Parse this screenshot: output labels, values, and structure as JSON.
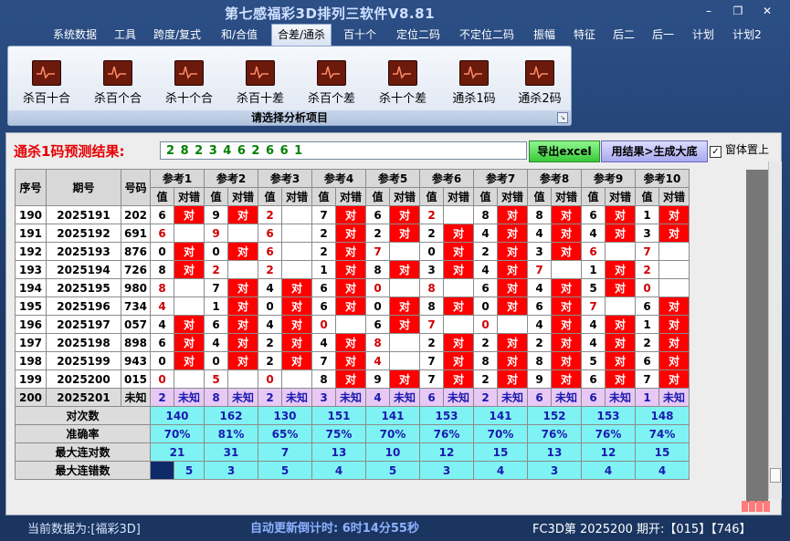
{
  "window": {
    "title": "第七感福彩3D排列三软件V8.81",
    "minimize": "–",
    "restore": "❐",
    "close": "✕"
  },
  "menu": [
    "系统数据",
    "工具",
    "跨度/复式",
    "和/合值",
    "合差/通杀",
    "百十个",
    "定位二码",
    "不定位二码",
    "振幅",
    "特征",
    "后二",
    "后一",
    "计划",
    "计划2"
  ],
  "ribbon": {
    "buttons": [
      "杀百十合",
      "杀百个合",
      "杀十个合",
      "杀百十差",
      "杀百个差",
      "杀十个差",
      "通杀1码",
      "通杀2码"
    ],
    "caption": "请选择分析项目"
  },
  "prediction": {
    "label": "通杀1码预测结果:",
    "value": "2 8 2 3 4 6 2 6 6 1",
    "export_button": "导出excel",
    "generate_button": "用结果>生成大底",
    "pin_label": "窗体置上",
    "pin_checked": true
  },
  "grid": {
    "headers": {
      "seq": "序号",
      "period": "期号",
      "code": "号码",
      "groups": [
        "参考1",
        "参考2",
        "参考3",
        "参考4",
        "参考5",
        "参考6",
        "参考7",
        "参考8",
        "参考9",
        "参考10"
      ],
      "val": "值",
      "mark": "对错"
    },
    "rows": [
      {
        "seq": "190",
        "period": "2025191",
        "code": "202",
        "cells": [
          [
            "6",
            "对"
          ],
          [
            "9",
            "对"
          ],
          [
            "2",
            ""
          ],
          [
            "7",
            "对"
          ],
          [
            "6",
            "对"
          ],
          [
            "2",
            ""
          ],
          [
            "8",
            "对"
          ],
          [
            "8",
            "对"
          ],
          [
            "6",
            "对"
          ],
          [
            "1",
            "对"
          ]
        ]
      },
      {
        "seq": "191",
        "period": "2025192",
        "code": "691",
        "cells": [
          [
            "6",
            ""
          ],
          [
            "9",
            ""
          ],
          [
            "6",
            ""
          ],
          [
            "2",
            "对"
          ],
          [
            "2",
            "对"
          ],
          [
            "2",
            "对"
          ],
          [
            "4",
            "对"
          ],
          [
            "4",
            "对"
          ],
          [
            "4",
            "对"
          ],
          [
            "3",
            "对"
          ]
        ]
      },
      {
        "seq": "192",
        "period": "2025193",
        "code": "876",
        "cells": [
          [
            "0",
            "对"
          ],
          [
            "0",
            "对"
          ],
          [
            "6",
            ""
          ],
          [
            "2",
            "对"
          ],
          [
            "7",
            ""
          ],
          [
            "0",
            "对"
          ],
          [
            "2",
            "对"
          ],
          [
            "3",
            "对"
          ],
          [
            "6",
            ""
          ],
          [
            "7",
            ""
          ]
        ]
      },
      {
        "seq": "193",
        "period": "2025194",
        "code": "726",
        "cells": [
          [
            "8",
            "对"
          ],
          [
            "2",
            ""
          ],
          [
            "2",
            ""
          ],
          [
            "1",
            "对"
          ],
          [
            "8",
            "对"
          ],
          [
            "3",
            "对"
          ],
          [
            "4",
            "对"
          ],
          [
            "7",
            ""
          ],
          [
            "1",
            "对"
          ],
          [
            "2",
            ""
          ]
        ]
      },
      {
        "seq": "194",
        "period": "2025195",
        "code": "980",
        "cells": [
          [
            "8",
            ""
          ],
          [
            "7",
            "对"
          ],
          [
            "4",
            "对"
          ],
          [
            "6",
            "对"
          ],
          [
            "0",
            ""
          ],
          [
            "8",
            ""
          ],
          [
            "6",
            "对"
          ],
          [
            "4",
            "对"
          ],
          [
            "5",
            "对"
          ],
          [
            "0",
            ""
          ]
        ]
      },
      {
        "seq": "195",
        "period": "2025196",
        "code": "734",
        "cells": [
          [
            "4",
            ""
          ],
          [
            "1",
            "对"
          ],
          [
            "0",
            "对"
          ],
          [
            "6",
            "对"
          ],
          [
            "0",
            "对"
          ],
          [
            "8",
            "对"
          ],
          [
            "0",
            "对"
          ],
          [
            "6",
            "对"
          ],
          [
            "7",
            ""
          ],
          [
            "6",
            "对"
          ]
        ]
      },
      {
        "seq": "196",
        "period": "2025197",
        "code": "057",
        "cells": [
          [
            "4",
            "对"
          ],
          [
            "6",
            "对"
          ],
          [
            "4",
            "对"
          ],
          [
            "0",
            ""
          ],
          [
            "6",
            "对"
          ],
          [
            "7",
            ""
          ],
          [
            "0",
            ""
          ],
          [
            "4",
            "对"
          ],
          [
            "4",
            "对"
          ],
          [
            "1",
            "对"
          ]
        ]
      },
      {
        "seq": "197",
        "period": "2025198",
        "code": "898",
        "cells": [
          [
            "6",
            "对"
          ],
          [
            "4",
            "对"
          ],
          [
            "2",
            "对"
          ],
          [
            "4",
            "对"
          ],
          [
            "8",
            ""
          ],
          [
            "2",
            "对"
          ],
          [
            "2",
            "对"
          ],
          [
            "2",
            "对"
          ],
          [
            "4",
            "对"
          ],
          [
            "2",
            "对"
          ]
        ]
      },
      {
        "seq": "198",
        "period": "2025199",
        "code": "943",
        "cells": [
          [
            "0",
            "对"
          ],
          [
            "0",
            "对"
          ],
          [
            "2",
            "对"
          ],
          [
            "7",
            "对"
          ],
          [
            "4",
            ""
          ],
          [
            "7",
            "对"
          ],
          [
            "8",
            "对"
          ],
          [
            "8",
            "对"
          ],
          [
            "5",
            "对"
          ],
          [
            "6",
            "对"
          ]
        ]
      },
      {
        "seq": "199",
        "period": "2025200",
        "code": "015",
        "cells": [
          [
            "0",
            ""
          ],
          [
            "5",
            ""
          ],
          [
            "0",
            ""
          ],
          [
            "8",
            "对"
          ],
          [
            "9",
            "对"
          ],
          [
            "7",
            "对"
          ],
          [
            "2",
            "对"
          ],
          [
            "9",
            "对"
          ],
          [
            "6",
            "对"
          ],
          [
            "7",
            "对"
          ]
        ]
      }
    ],
    "pred_row": {
      "seq": "200",
      "period": "2025201",
      "code": "未知",
      "values": [
        "2",
        "8",
        "2",
        "3",
        "4",
        "6",
        "2",
        "6",
        "6",
        "1"
      ],
      "mark": "未知"
    },
    "stats": [
      {
        "label": "对次数",
        "values": [
          "140",
          "162",
          "130",
          "151",
          "141",
          "153",
          "141",
          "152",
          "153",
          "148"
        ]
      },
      {
        "label": "准确率",
        "values": [
          "70%",
          "81%",
          "65%",
          "75%",
          "70%",
          "76%",
          "70%",
          "76%",
          "76%",
          "74%"
        ]
      },
      {
        "label": "最大连对数",
        "values": [
          "21",
          "31",
          "7",
          "13",
          "10",
          "12",
          "15",
          "13",
          "12",
          "15"
        ]
      },
      {
        "label": "最大连错数",
        "values": [
          "5",
          "3",
          "5",
          "4",
          "5",
          "3",
          "4",
          "3",
          "4",
          "4"
        ]
      }
    ]
  },
  "colors": {
    "wrong_cell": "#ff0000",
    "stats_bg": "#7ff3f3",
    "pred_bg": "#e8c8f4"
  },
  "statusbar": {
    "current_data": "当前数据为:[福彩3D]",
    "countdown": "自动更新倒计时:  6时14分55秒",
    "issue_info": "FC3D第 2025200 期开:【015】【746】"
  }
}
